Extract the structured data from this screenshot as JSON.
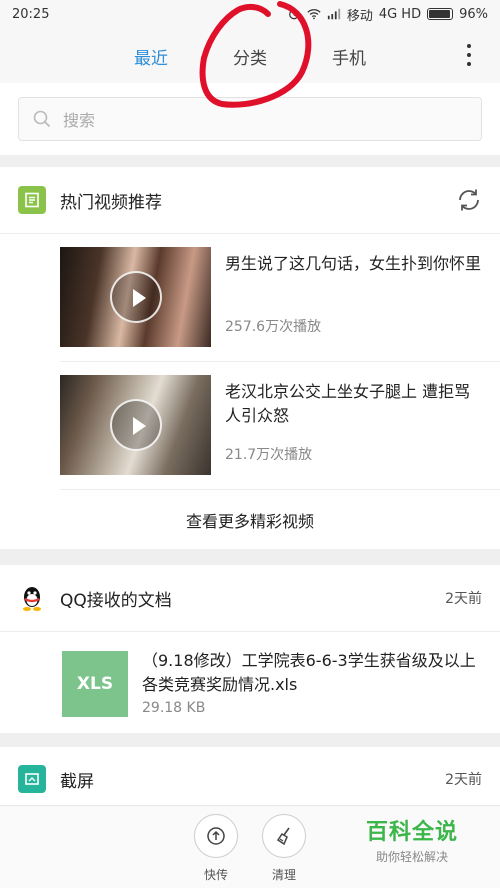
{
  "status": {
    "time": "20:25",
    "carrier": "移动",
    "network": "4G HD",
    "battery": "96%"
  },
  "tabs": [
    {
      "label": "最近",
      "active": true
    },
    {
      "label": "分类",
      "active": false
    },
    {
      "label": "手机",
      "active": false
    }
  ],
  "search": {
    "placeholder": "搜索"
  },
  "hot_videos": {
    "title": "热门视频推荐",
    "items": [
      {
        "title": "男生说了这几句话，女生扑到你怀里",
        "plays": "257.6万次播放"
      },
      {
        "title": "老汉北京公交上坐女子腿上 遭拒骂人引众怒",
        "plays": "21.7万次播放"
      }
    ],
    "more_label": "查看更多精彩视频"
  },
  "qq_docs": {
    "title": "QQ接收的文档",
    "time": "2天前",
    "file": {
      "type_label": "XLS",
      "name": "（9.18修改）工学院表6-6-3学生获省级及以上各类竞赛奖励情况.xls",
      "size": "29.18 KB"
    }
  },
  "screenshots": {
    "title": "截屏",
    "time": "2天前"
  },
  "bottom": {
    "share_label": "快传",
    "clean_label": "清理"
  },
  "watermark": {
    "title": "百科全说",
    "subtitle": "助你轻松解决"
  },
  "colors": {
    "accent": "#2f8ed9",
    "doc_icon": "#8bc34a",
    "xls": "#7cc48b",
    "screenshot_icon": "#26b59a",
    "annotation": "#e0102a"
  }
}
